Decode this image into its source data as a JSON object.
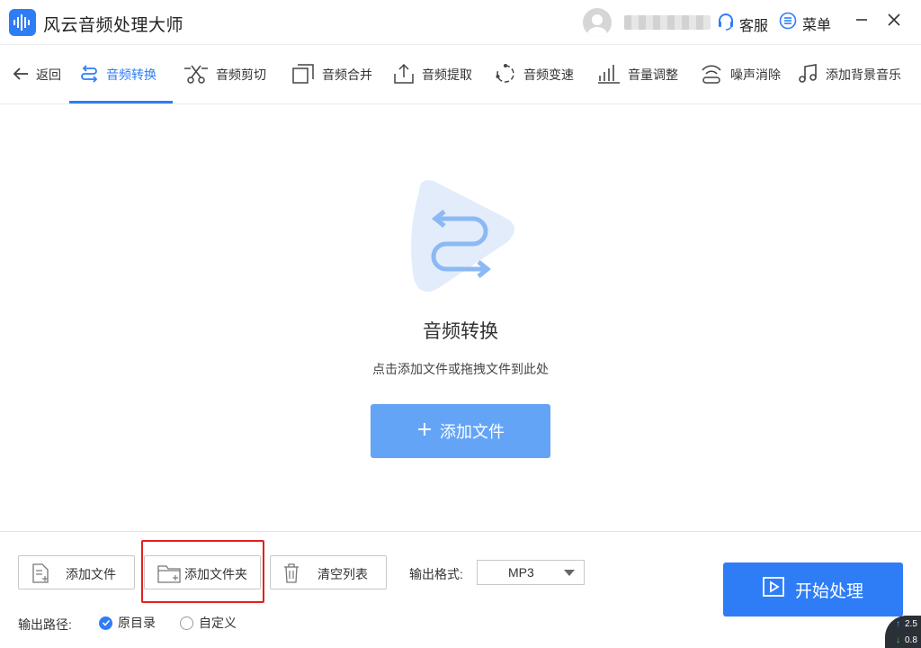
{
  "app": {
    "title": "风云音频处理大师"
  },
  "header": {
    "service_label": "客服",
    "menu_label": "菜单"
  },
  "tabs": [
    {
      "label": "返回"
    },
    {
      "label": "音频转换"
    },
    {
      "label": "音频剪切"
    },
    {
      "label": "音频合并"
    },
    {
      "label": "音频提取"
    },
    {
      "label": "音频变速"
    },
    {
      "label": "音量调整"
    },
    {
      "label": "噪声消除"
    },
    {
      "label": "添加背景音乐"
    }
  ],
  "main": {
    "title": "音频转换",
    "hint": "点击添加文件或拖拽文件到此处",
    "add_file_button": "添加文件"
  },
  "bottom": {
    "add_file": "添加文件",
    "add_folder": "添加文件夹",
    "clear_list": "清空列表",
    "format_label": "输出格式:",
    "format_value": "MP3",
    "start_button": "开始处理",
    "path_label": "输出路径:",
    "path_options": [
      {
        "label": "原目录",
        "checked": true
      },
      {
        "label": "自定义",
        "checked": false
      }
    ]
  },
  "network": {
    "up": "2.5",
    "down": "0.8"
  },
  "colors": {
    "accent": "#2f7df6",
    "accent_light": "#64a4f6",
    "highlight": "#e02020"
  }
}
